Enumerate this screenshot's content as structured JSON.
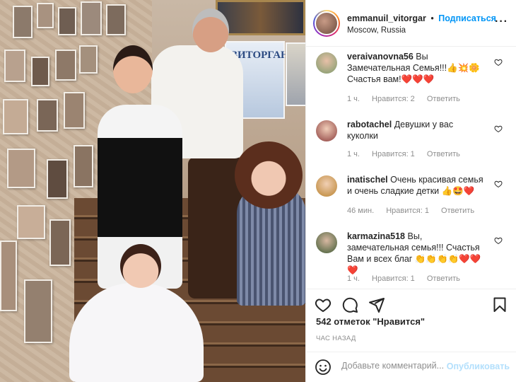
{
  "post": {
    "author": "emmanuil_vitorgar",
    "separator": "•",
    "follow_label": "Подписаться",
    "location": "Moscow, Russia",
    "more_icon": "more-horizontal-icon",
    "poster_text": "ВИТОРГАН"
  },
  "comments": [
    {
      "user": "veraivanovna56",
      "text": "Вы Замечательная Семья!!!👍💥🌼 Счастья вам!❤️❤️❤️",
      "time": "1 ч.",
      "likes": "Нравится: 2",
      "reply": "Ответить"
    },
    {
      "user": "rabotachel",
      "text": "Девушки у вас куколки",
      "time": "1 ч.",
      "likes": "Нравится: 1",
      "reply": "Ответить"
    },
    {
      "user": "inatischel",
      "text": "Очень красивая семья и очень сладкие детки 👍🤩❤️",
      "time": "46 мин.",
      "likes": "Нравится: 1",
      "reply": "Ответить"
    },
    {
      "user": "karmazina518",
      "text": "Вы, замечательная семья!!! Счастья Вам и всех благ 👏👏👏👏❤️❤️❤️",
      "time": "1 ч.",
      "likes": "Нравится: 1",
      "reply": "Ответить"
    }
  ],
  "actions": {
    "like_icon": "heart-icon",
    "comment_icon": "comment-icon",
    "share_icon": "share-icon",
    "save_icon": "bookmark-icon"
  },
  "likes_text": "542 отметок \"Нравится\"",
  "time_ago": "ЧАС НАЗАД",
  "add_comment": {
    "placeholder": "Добавьте комментарий...",
    "publish_label": "Опубликовать",
    "emoji_icon": "smiley-icon"
  },
  "colors": {
    "accent": "#0095f6",
    "publish_disabled": "#b2dffc",
    "text": "#262626",
    "muted": "#8e8e8e",
    "divider": "#efefef"
  }
}
